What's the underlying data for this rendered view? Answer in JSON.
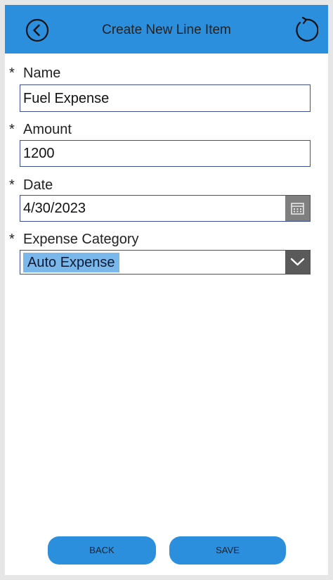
{
  "header": {
    "title": "Create New Line Item",
    "back_icon": "chevron-left-circle-icon",
    "refresh_icon": "refresh-icon",
    "color": "#2b8fde"
  },
  "form": {
    "required_marker": "*",
    "name": {
      "label": "Name",
      "value": "Fuel Expense"
    },
    "amount": {
      "label": "Amount",
      "value": "1200"
    },
    "date": {
      "label": "Date",
      "value": "4/30/2023",
      "icon": "calendar-icon"
    },
    "category": {
      "label": "Expense Category",
      "value": "Auto Expense",
      "icon": "chevron-down-icon"
    }
  },
  "footer": {
    "back_label": "BACK",
    "save_label": "SAVE"
  }
}
